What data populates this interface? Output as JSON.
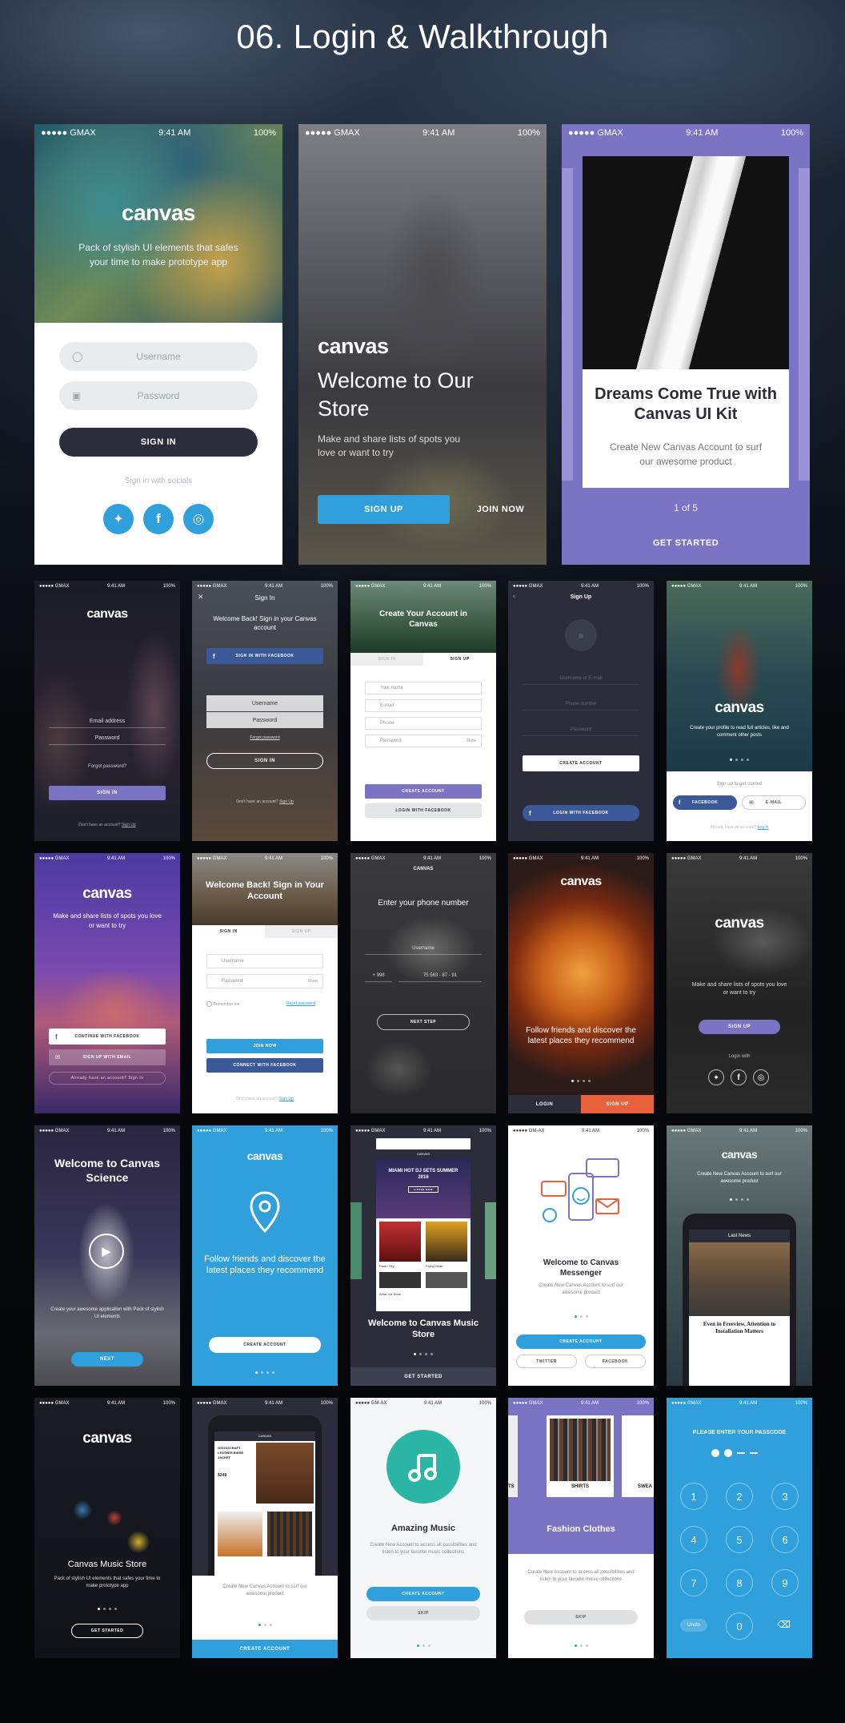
{
  "page": {
    "title": "06. Login & Walkthrough"
  },
  "status": {
    "carrier": "●●●●● GMAX",
    "carrier2": "●●●●● GM-AX",
    "time": "9:41 AM",
    "battery": "100%"
  },
  "s1": {
    "logo": "canvas",
    "tagline": "Pack of stylish UI elements that safes your time to make prototype app",
    "username_ph": "Username",
    "password_ph": "Password",
    "sign_in": "SIGN IN",
    "social": "Sign in with socials"
  },
  "s2": {
    "logo": "canvas",
    "heading": "Welcome to Our Store",
    "sub": "Make and share lists of spots you love or want to try",
    "signup": "SIGN UP",
    "join": "JOIN NOW"
  },
  "s3": {
    "heading": "Dreams Come True with Canvas UI Kit",
    "sub": "Create New Canvas Account to surf our awesome product",
    "pager": "1 of 5",
    "cta": "GET STARTED"
  },
  "r2a": {
    "logo": "canvas",
    "email": "Email address",
    "password": "Password",
    "forgot": "Forgot password?",
    "signin": "SIGN IN",
    "footer": "Don't have an account?",
    "footer_link": "Sign Up"
  },
  "r2b": {
    "title": "Sign In",
    "welcome": "Welcome Back! Sign in your Canvas account",
    "fb": "SIGN IN WITH FACEBOOK",
    "username": "Username",
    "password": "Password",
    "forgot": "Forgot password",
    "signin": "SIGN IN",
    "footer": "Don't have an account?",
    "footer_link": "Sign Up"
  },
  "r2c": {
    "heading": "Create Your Account in Canvas",
    "tab1": "SIGN IN",
    "tab2": "SIGN UP",
    "f1": "Your name",
    "f2": "E-mail",
    "f3": "Phone",
    "f4": "Password",
    "show": "Show",
    "create": "CREATE ACCOUNT",
    "fb": "LOGIN WITH FACEBOOK"
  },
  "r2d": {
    "title": "Sign Up",
    "f1": "Username or E-mail",
    "f2": "Phone number",
    "f3": "Password",
    "create": "CREATE ACCOUNT",
    "fb": "LOGIN WITH FACEBOOK"
  },
  "r2e": {
    "logo": "canvas",
    "sub": "Create your profile to read full articles, like and comment other posts",
    "signup": "Sign up to get started",
    "fb": "FACEBOOK",
    "email": "E-MAIL",
    "footer": "Already have an account?",
    "footer_link": "Log In"
  },
  "r3a": {
    "logo": "canvas",
    "sub": "Make and share lists of spots you love or want to try",
    "fb": "CONTINUE WITH FACEBOOK",
    "email": "SIGN UP WITH EMAIL",
    "footer": "Already have an account?",
    "footer_link": "Sign In"
  },
  "r3b": {
    "heading": "Welcome Back! Sign in Your Account",
    "tab1": "SIGN IN",
    "tab2": "SIGN UP",
    "f1": "Username",
    "f2": "Password",
    "show": "Show",
    "remember": "Remember me",
    "reset": "Reset password",
    "join": "JOIN NOW",
    "fb": "CONNECT WITH FACEBOOK",
    "footer": "Don't have an account?",
    "footer_link": "Sign Up"
  },
  "r3c": {
    "logo": "CANVAS",
    "heading": "Enter your phone number",
    "username": "Username",
    "code": "+ 998",
    "phone": "75 563 - 87 - 91",
    "next": "NEXT STEP"
  },
  "r3d": {
    "logo": "canvas",
    "text": "Follow friends and discover the latest places they recommend",
    "login": "LOGIN",
    "signup": "SIGN UP"
  },
  "r3e": {
    "logo": "canvas",
    "sub": "Make and share lists of spots you love or want to try",
    "signup": "SIGN UP",
    "login": "Login with"
  },
  "r4a": {
    "heading": "Welcome to Canvas Science",
    "sub": "Create your awesome application with Pack of stylish UI elements",
    "next": "NEXT"
  },
  "r4b": {
    "logo": "canvas",
    "text": "Follow friends and discover the latest places they recommend",
    "create": "CREATE ACCOUNT"
  },
  "r4c": {
    "app": "CANVAS",
    "card": "MIAMI HOT DJ SETS SUMMER 2016",
    "listen": "LISTEN NOW",
    "t1": "Radio City",
    "t2": "Flying Heart",
    "t3": "What I've Done",
    "heading": "Welcome to Canvas Music Store",
    "cta": "GET STARTED"
  },
  "r4d": {
    "heading": "Welcome to Canvas Messenger",
    "sub": "Create New Canvas Account to surf our awesome product",
    "create": "CREATE ACCOUNT",
    "twitter": "TWITTER",
    "fb": "FACEBOOK"
  },
  "r4e": {
    "logo": "canvas",
    "sub": "Create New Canvas Account to surf our awesome product",
    "news": "Last News",
    "article": "Even in Freeview, Attention to Installation Matters"
  },
  "r5a": {
    "logo": "canvas",
    "heading": "Canvas Music Store",
    "sub": "Pack of stylish UI elements that safes your time to make prototype app",
    "cta": "GET STARTED"
  },
  "r5b": {
    "app": "CANVAS",
    "product": "GOODSCRAFT LEATHER BIKER JACKET",
    "price": "$249",
    "sub": "Create New Canvas Account to surf our awesome product",
    "create": "CREATE ACCOUNT"
  },
  "r5c": {
    "heading": "Amazing Music",
    "sub": "Create New Account to access all possibilities and listen to your favorite music collections",
    "create": "CREATE ACCOUNT",
    "skip": "SKIP"
  },
  "r5d": {
    "label": "SHIRTS",
    "label_left": "TS",
    "label_right": "SWEA",
    "heading": "Fashion Clothes",
    "sub": "Create New Account to access all possibilities and listen to your favorite music collections",
    "skip": "SKIP"
  },
  "r5e": {
    "heading": "PLEASE ENTER YOUR PASSCODE",
    "keys": [
      "1",
      "2",
      "3",
      "4",
      "5",
      "6",
      "7",
      "8",
      "9",
      "0"
    ],
    "undo": "Undo"
  },
  "colors": {
    "accent_blue": "#2fa0db",
    "purple": "#7b73c4",
    "dark": "#2b2e3a",
    "orange": "#e8603c",
    "fb": "#3b5998"
  }
}
